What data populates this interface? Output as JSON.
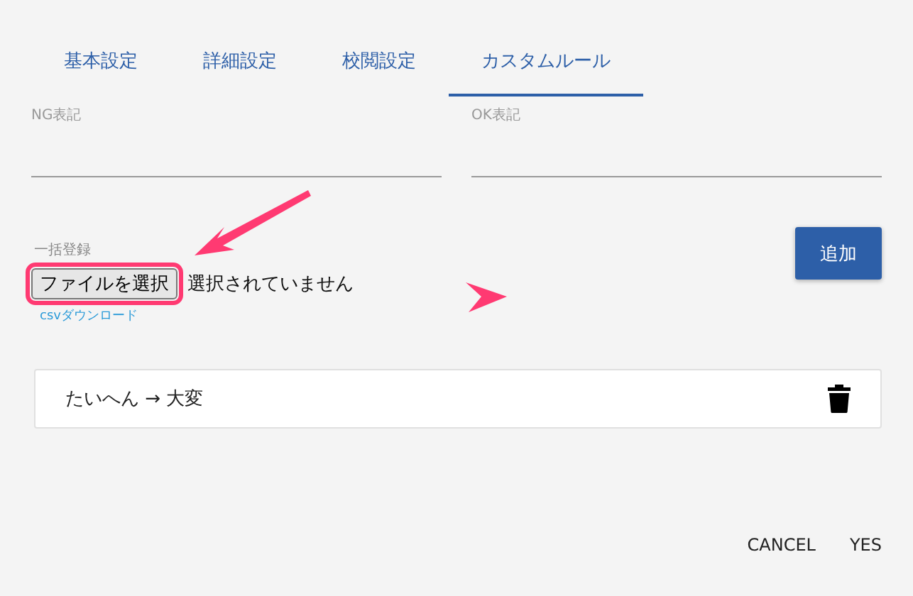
{
  "tabs": [
    {
      "label": "基本設定",
      "selected": false
    },
    {
      "label": "詳細設定",
      "selected": false
    },
    {
      "label": "校閲設定",
      "selected": false
    },
    {
      "label": "カスタムルール",
      "selected": true
    }
  ],
  "fields": [
    {
      "label": "NG表記"
    },
    {
      "label": "OK表記"
    }
  ],
  "bulk": {
    "label": "一括登録",
    "file_button": "ファイルを選択",
    "file_status": "選択されていません",
    "download_link": "csvダウンロード"
  },
  "add_button": "追加",
  "rules": [
    {
      "text": "たいへん → 大変"
    }
  ],
  "annotations": [
    {
      "kind": "arrow"
    },
    {
      "kind": "outline"
    },
    {
      "kind": "arrowhead"
    }
  ],
  "buttons": [
    "CANCEL",
    "YES"
  ]
}
